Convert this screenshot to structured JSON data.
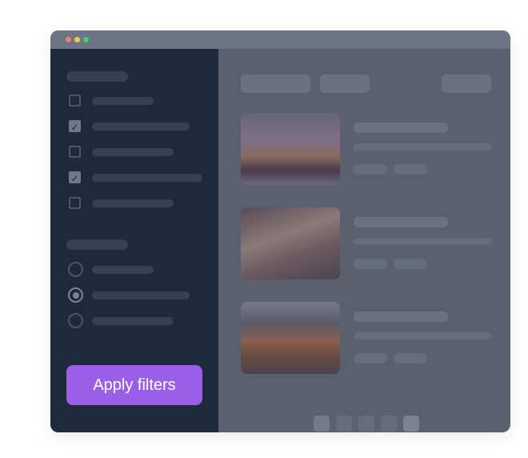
{
  "window": {
    "controls": [
      "close",
      "minimize",
      "maximize"
    ],
    "colors": {
      "close": "#f27c7c",
      "minimize": "#f0c94a",
      "maximize": "#4ccb7a"
    }
  },
  "sidebar": {
    "checkboxes": [
      {
        "checked": false
      },
      {
        "checked": true
      },
      {
        "checked": false
      },
      {
        "checked": true
      },
      {
        "checked": false
      }
    ],
    "radios": [
      {
        "selected": false
      },
      {
        "selected": true
      },
      {
        "selected": false
      }
    ],
    "apply_button": "Apply filters",
    "accent": "#9a5ee8"
  },
  "main": {
    "results": [
      {
        "image": "overwater-bungalow-thatched-roof"
      },
      {
        "image": "thatched-roof-interior-dusk"
      },
      {
        "image": "overwater-villa-lit-at-dusk"
      }
    ],
    "pagination": {
      "pages": 5,
      "active": [
        1,
        5
      ]
    }
  }
}
